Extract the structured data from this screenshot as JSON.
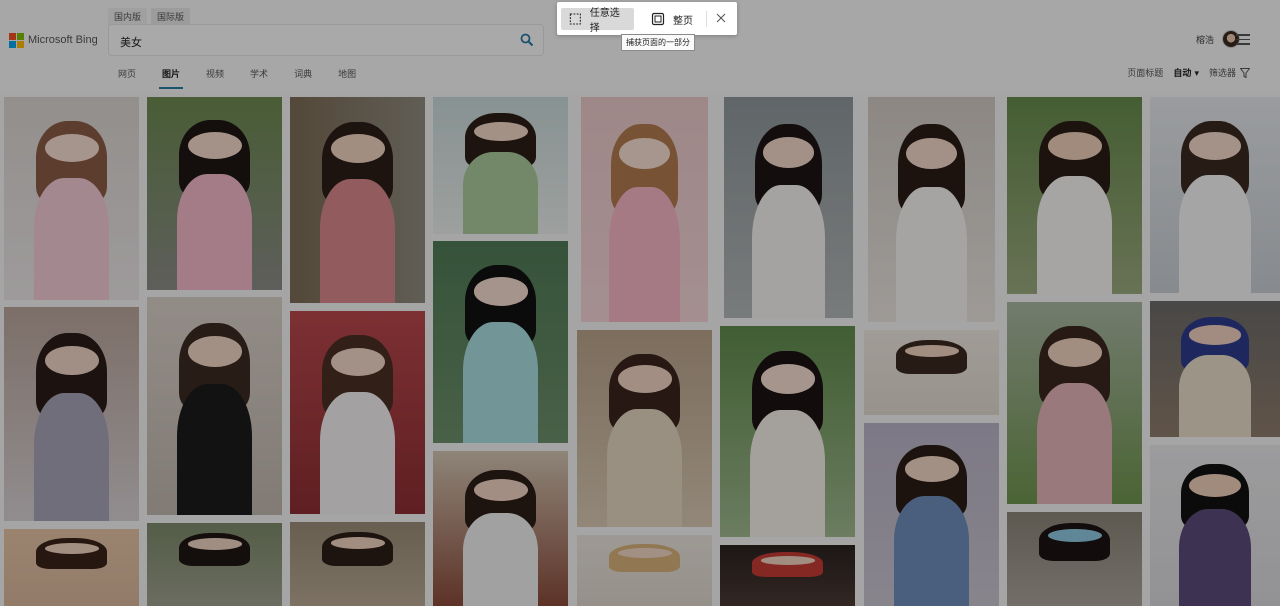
{
  "logo": {
    "text": "Microsoft Bing"
  },
  "scope_tabs": [
    {
      "label": "国内版"
    },
    {
      "label": "国际版"
    }
  ],
  "search": {
    "value": "美女"
  },
  "verticals": [
    {
      "label": "网页"
    },
    {
      "label": "图片"
    },
    {
      "label": "视频"
    },
    {
      "label": "学术"
    },
    {
      "label": "词典"
    },
    {
      "label": "地图"
    }
  ],
  "user": {
    "name": "榕浩"
  },
  "filters": {
    "page_title_label": "页面标题",
    "auto_label": "自动",
    "filter_label": "筛选器"
  },
  "snip_toolbar": {
    "freeform_label": "任意选择",
    "fullpage_label": "整页",
    "tooltip": "捕获页面的一部分"
  },
  "colors": {
    "accent": "#2a79a3",
    "search_icon": "#2a79a3"
  }
}
